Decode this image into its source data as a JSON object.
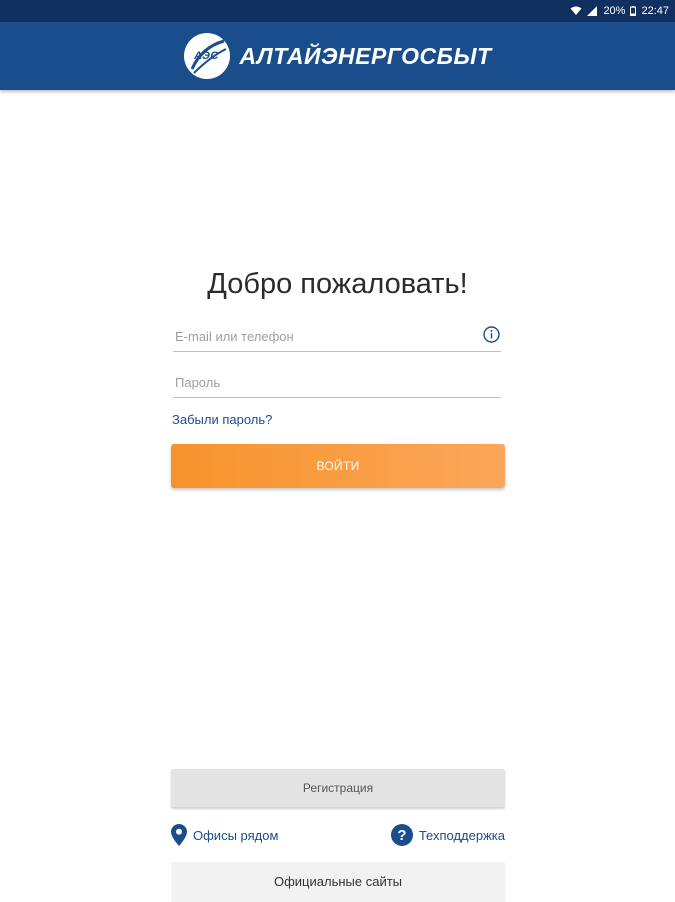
{
  "status_bar": {
    "battery": "20%",
    "time": "22:47",
    "icons": [
      "wifi-icon",
      "signal-icon",
      "battery-icon"
    ]
  },
  "header": {
    "logo_abbr": "АЭС",
    "brand": "АЛТАЙЭНЕРГОСБЫТ"
  },
  "login": {
    "welcome": "Добро пожаловать!",
    "email_placeholder": "E-mail или телефон",
    "email_value": "",
    "password_placeholder": "Пароль",
    "password_value": "",
    "forgot": "Забыли пароль?",
    "submit": "ВОЙТИ"
  },
  "footer": {
    "register": "Регистрация",
    "offices": "Офисы рядом",
    "support": "Техподдержка",
    "sites": "Официальные сайты"
  },
  "colors": {
    "header": "#1a4d8c",
    "status_bar": "#12305f",
    "accent_orange": "#f7932a",
    "link": "#1a4d8c"
  }
}
